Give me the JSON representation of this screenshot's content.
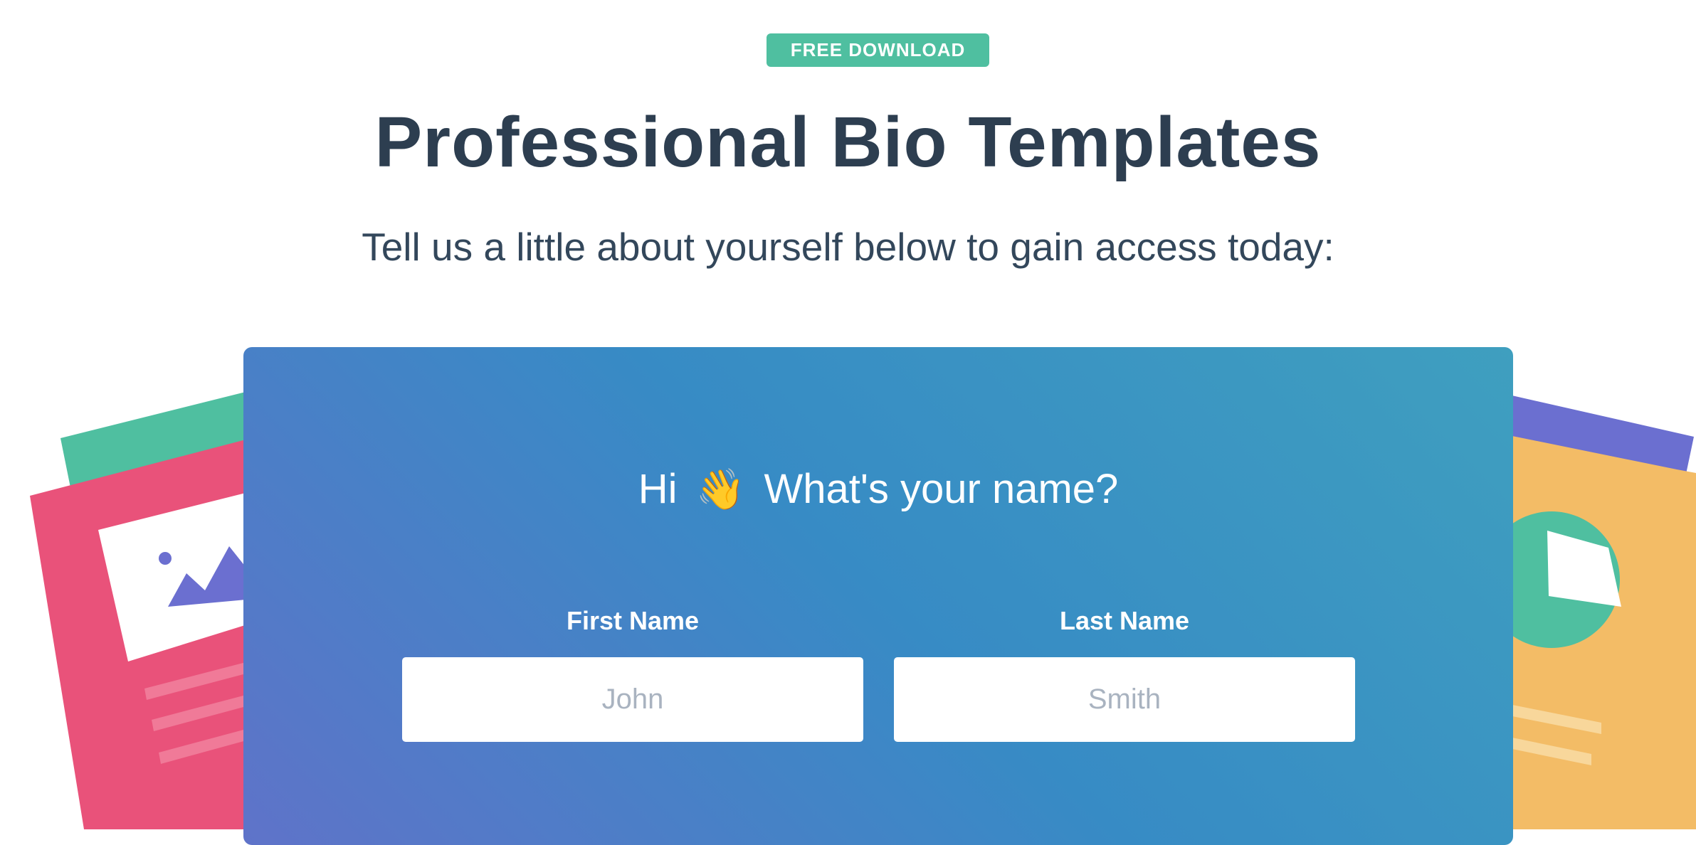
{
  "badge": {
    "label": "FREE DOWNLOAD"
  },
  "header": {
    "title": "Professional Bio Templates",
    "subtitle": "Tell us a little about yourself below to gain access today:"
  },
  "form": {
    "greeting_prefix": "Hi",
    "greeting_icon": "waving-hand-icon",
    "greeting_text": "What's your name?",
    "first_name": {
      "label": "First Name",
      "placeholder": "John",
      "value": ""
    },
    "last_name": {
      "label": "Last Name",
      "placeholder": "Smith",
      "value": ""
    }
  },
  "colors": {
    "badge": "#4fbfa0",
    "title": "#2d3e50",
    "card_gradient": [
      "#5f73c9",
      "#378bc5",
      "#3f9fbf"
    ],
    "doc_pink": "#e9527a",
    "doc_teal": "#4fbfa0",
    "doc_purple": "#6b6fd0",
    "doc_orange": "#f3bc66"
  }
}
